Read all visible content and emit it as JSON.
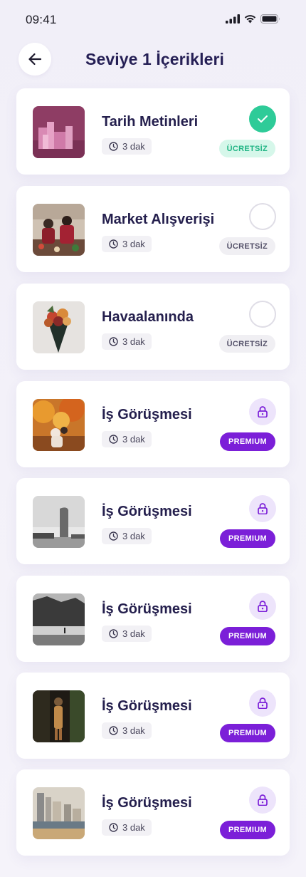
{
  "status_bar": {
    "time": "09:41"
  },
  "header": {
    "title": "Seviye 1 İçerikleri"
  },
  "colors": {
    "accent_premium": "#7b1fd8",
    "done_green": "#2ecb98",
    "title_text": "#251f55"
  },
  "items": [
    {
      "title": "Tarih Metinleri",
      "duration": "3 dak",
      "badge": "ÜCRETSİZ",
      "state": "completed",
      "thumbnail": "pink-buildings-photo"
    },
    {
      "title": "Market Alışverişi",
      "duration": "3 dak",
      "badge": "ÜCRETSİZ",
      "state": "not-started",
      "thumbnail": "market-people-photo"
    },
    {
      "title": "Havaalanında",
      "duration": "3 dak",
      "badge": "ÜCRETSİZ",
      "state": "not-started",
      "thumbnail": "flower-bouquet-photo"
    },
    {
      "title": "İş Görüşmesi",
      "duration": "3 dak",
      "badge": "PREMIUM",
      "state": "locked",
      "thumbnail": "autumn-couple-photo"
    },
    {
      "title": "İş Görüşmesi",
      "duration": "3 dak",
      "badge": "PREMIUM",
      "state": "locked",
      "thumbnail": "bw-tower-photo"
    },
    {
      "title": "İş Görüşmesi",
      "duration": "3 dak",
      "badge": "PREMIUM",
      "state": "locked",
      "thumbnail": "bw-forest-beach-photo"
    },
    {
      "title": "İş Görüşmesi",
      "duration": "3 dak",
      "badge": "PREMIUM",
      "state": "locked",
      "thumbnail": "dark-portrait-photo"
    },
    {
      "title": "İş Görüşmesi",
      "duration": "3 dak",
      "badge": "PREMIUM",
      "state": "locked",
      "thumbnail": "city-beach-photo"
    }
  ]
}
